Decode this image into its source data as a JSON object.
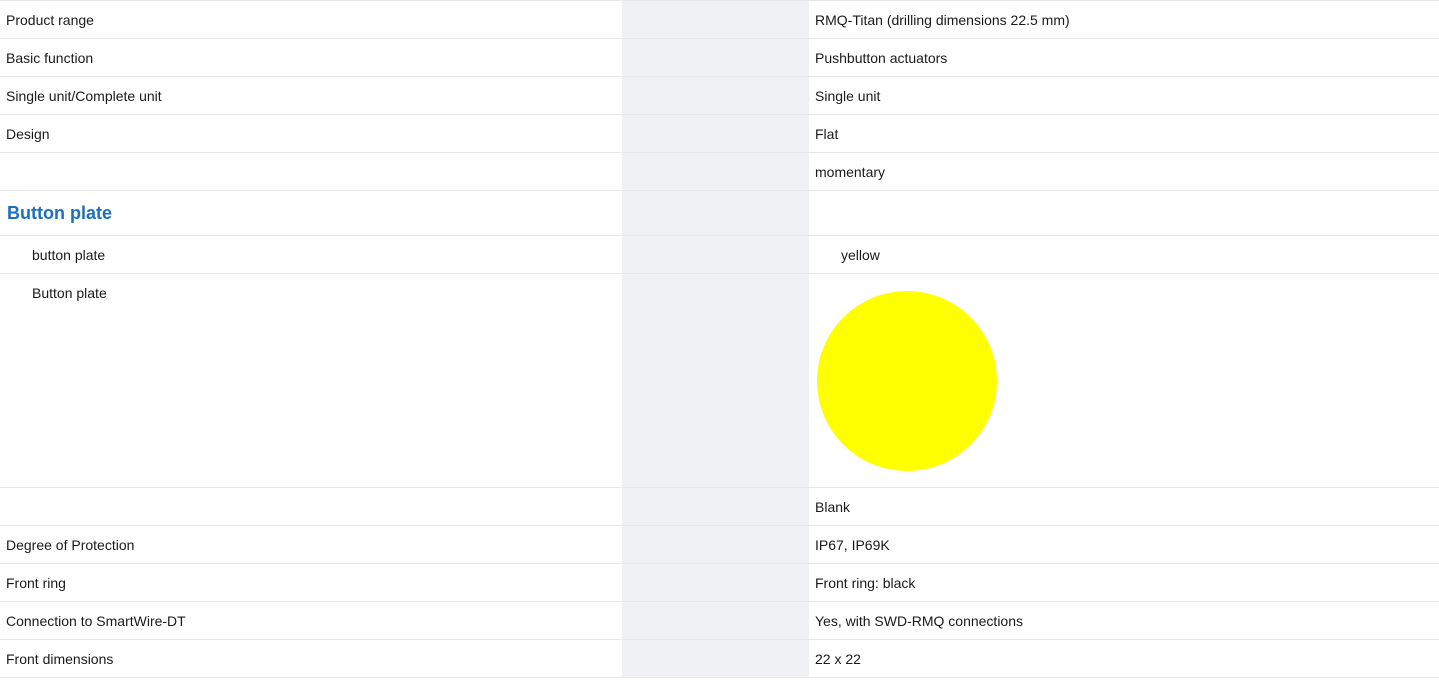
{
  "specs": {
    "product_range": {
      "label": "Product range",
      "value": "RMQ-Titan (drilling dimensions 22.5 mm)"
    },
    "basic_function": {
      "label": "Basic function",
      "value": "Pushbutton actuators"
    },
    "unit_type": {
      "label": "Single unit/Complete unit",
      "value": "Single unit"
    },
    "design": {
      "label": "Design",
      "value": "Flat"
    },
    "actuation": {
      "label": "",
      "value": "momentary"
    },
    "button_plate_section": {
      "title": "Button plate"
    },
    "button_plate_color": {
      "label": "button plate",
      "value": "yellow"
    },
    "button_plate_image": {
      "label": "Button plate",
      "swatch_color": "#ffff00"
    },
    "inscription": {
      "label": "",
      "value": "Blank"
    },
    "degree_of_protection": {
      "label": "Degree of Protection",
      "value": "IP67, IP69K"
    },
    "front_ring": {
      "label": "Front ring",
      "value": "Front ring: black"
    },
    "smartwire": {
      "label": "Connection to SmartWire-DT",
      "value": "Yes, with SWD-RMQ connections"
    },
    "front_dimensions": {
      "label": "Front dimensions",
      "value": "22 x 22"
    }
  },
  "colors": {
    "section_title": "#1a6fbe",
    "gap_column": "#f0f1f4",
    "divider": "#e6e8ec"
  }
}
